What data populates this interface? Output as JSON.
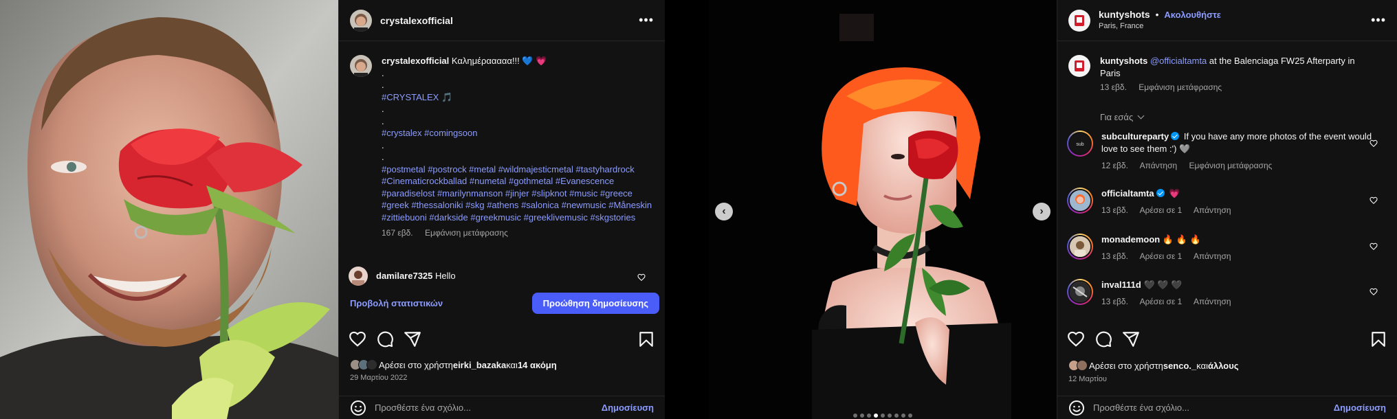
{
  "post1": {
    "header": {
      "username": "crystalexofficial",
      "more": "•••"
    },
    "caption": {
      "username": "crystalexofficial",
      "text": "Καλημέρααααα!!! 💙 💗",
      "dot1": ".",
      "dot2": ".",
      "line_crystalex": "#CRYSTALEX 🎵",
      "dot3": ".",
      "dot4": ".",
      "line_coming": "#crystalex #comingsoon",
      "dot5": ".",
      "dot6": ".",
      "hashtags": "#postmetal #postrock #metal #wildmajesticmetal #tastyhardrock #Cinematicrockballad #numetal #gothmetal #Evanescence #paradiselost #marilynmanson #jinjer #slipknot #music #greece #greek #thessaloniki #skg #athens #salonica #newmusic #Måneskin #zittiebuoni #darkside #greekmusic #greeklivemusic #skgstories",
      "age": "167 εβδ.",
      "translation": "Εμφάνιση μετάφρασης"
    },
    "comment": {
      "username": "damilare7325",
      "text": "Hello"
    },
    "insights_label": "Προβολή στατιστικών",
    "boost_label": "Προώθηση δημοσίευσης",
    "likes": {
      "prefix": "Αρέσει στο χρήστη ",
      "user": "eirki_bazaka",
      "middle": " και ",
      "others": "14 ακόμη"
    },
    "date": "29 Μαρτίου 2022",
    "add_comment": {
      "placeholder": "Προσθέστε ένα σχόλιο...",
      "publish": "Δημοσίευση"
    }
  },
  "post2": {
    "header": {
      "username": "kuntyshots",
      "separator": "•",
      "follow": "Ακολουθήστε",
      "location": "Paris, France",
      "more": "•••"
    },
    "caption": {
      "username": "kuntyshots",
      "mention": "@officialtamta",
      "text": " at the Balenciaga FW25 Afterparty in Paris",
      "age": "13 εβδ.",
      "translation": "Εμφάνιση μετάφρασης"
    },
    "for_you": "Για εσάς",
    "comments": [
      {
        "username": "subcultureparty",
        "text": "If you have any more photos of the event would love to see them :') 🩶",
        "age": "12 εβδ.",
        "action1": "Απάντηση",
        "action2": "Εμφάνιση μετάφρασης"
      },
      {
        "username": "officialtamta",
        "text": "💗",
        "age": "13 εβδ.",
        "action1": "Αρέσει σε 1",
        "action2": "Απάντηση"
      },
      {
        "username": "monademoon",
        "text": "🔥 🔥 🔥",
        "age": "13 εβδ.",
        "action1": "Αρέσει σε 1",
        "action2": "Απάντηση"
      },
      {
        "username": "inval111d",
        "text": "🖤 🖤 🖤",
        "age": "13 εβδ.",
        "action1": "Αρέσει σε 1",
        "action2": "Απάντηση"
      }
    ],
    "likes": {
      "prefix": "Αρέσει στο χρήστη ",
      "user": "senco._",
      "middle": " και ",
      "others": "άλλους"
    },
    "date": "12 Μαρτίου",
    "add_comment": {
      "placeholder": "Προσθέστε ένα σχόλιο...",
      "publish": "Δημοσίευση"
    },
    "carousel": {
      "prev": "‹",
      "next": "›",
      "slides": 9,
      "active_slide": 4
    }
  },
  "icons": {
    "heart": "heart-icon",
    "comment": "comment-icon",
    "share": "share-icon",
    "bookmark": "bookmark-icon",
    "smile": "emoji-icon",
    "more": "more-options-icon"
  },
  "colors": {
    "background": "#000000",
    "panel": "#121212",
    "link": "#8c9cff",
    "primary_button": "#4a5df9",
    "verified": "#0095f6"
  }
}
